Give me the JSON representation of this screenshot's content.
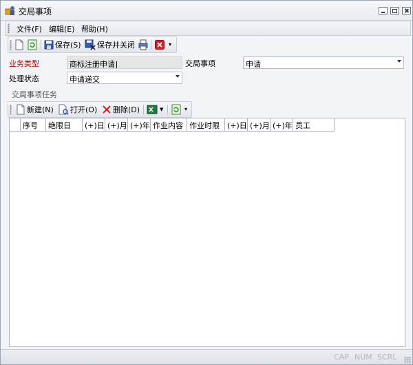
{
  "window": {
    "title": "交局事项"
  },
  "menu": {
    "file": "文件(F)",
    "edit": "编辑(E)",
    "help": "帮助(H)"
  },
  "toolbar": {
    "save": "保存(S)",
    "save_close": "保存并关闭"
  },
  "form": {
    "business_type_label": "业务类型",
    "business_type_value": "商标注册申请",
    "matter_label": "交局事项",
    "matter_value": "申请",
    "status_label": "处理状态",
    "status_value": "申请递交"
  },
  "tasks": {
    "group_title": "交局事项任务",
    "new": "新建(N)",
    "open": "打开(O)",
    "delete": "删除(D)",
    "columns": [
      "序号",
      "绝限日",
      "(+)日",
      "(+)月",
      "(+)年",
      "作业内容",
      "作业时限",
      "(+)日",
      "(+)月",
      "(+)年",
      "员工"
    ]
  },
  "statusbar": {
    "cap": "CAP",
    "num": "NUM",
    "scrl": "SCRL"
  }
}
